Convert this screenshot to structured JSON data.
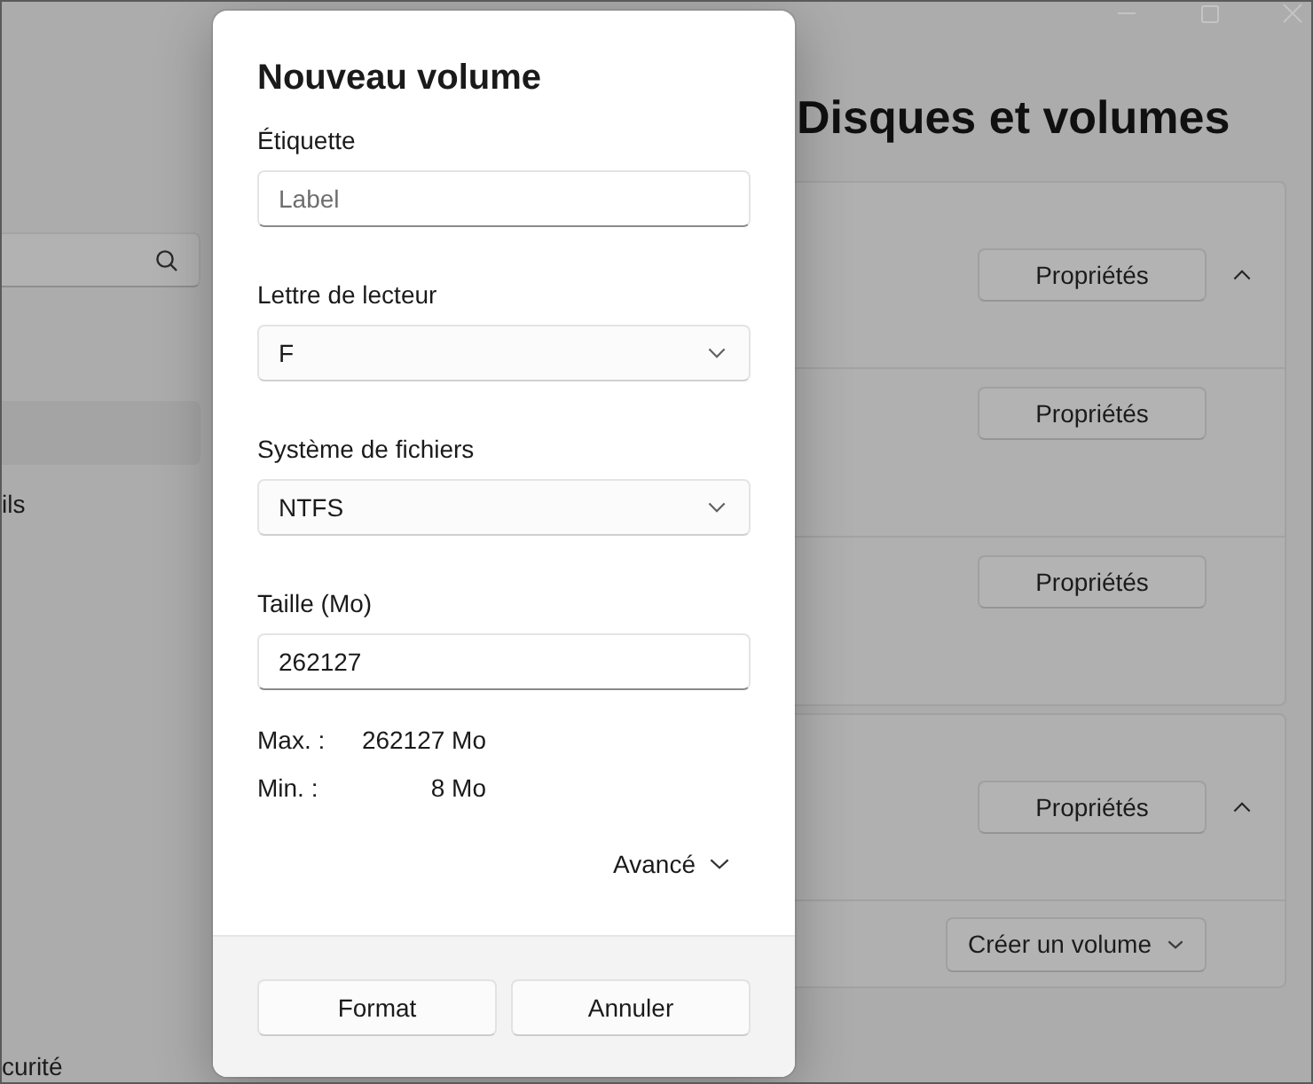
{
  "sidebar": {
    "items": [
      {
        "selected": true
      },
      {
        "label": "ils",
        "selected": false
      },
      {
        "label": "curité",
        "selected": false
      }
    ]
  },
  "page": {
    "title": "Disques et volumes",
    "cards": [
      {
        "rows": [
          {
            "kind": "disk",
            "button": "Propriétés",
            "expanded": true
          },
          {
            "kind": "volume",
            "button": "Propriétés"
          },
          {
            "kind": "volume",
            "button": "Propriétés"
          }
        ]
      },
      {
        "rows": [
          {
            "kind": "disk",
            "button": "Propriétés",
            "expanded": true
          },
          {
            "kind": "action",
            "button": "Créer un volume"
          }
        ]
      }
    ]
  },
  "dialog": {
    "title": "Nouveau volume",
    "fields": [
      {
        "kind": "text",
        "label": "Étiquette",
        "placeholder": "Label"
      },
      {
        "kind": "select",
        "label": "Lettre de lecteur",
        "value": "F"
      },
      {
        "kind": "select",
        "label": "Système de fichiers",
        "value": "NTFS"
      },
      {
        "kind": "text",
        "label": "Taille (Mo)",
        "value": "262127"
      }
    ],
    "limits": [
      {
        "label": "Max. :",
        "value": "262127 Mo"
      },
      {
        "label": "Min. :",
        "value": "8 Mo"
      }
    ],
    "advanced": {
      "label": "Avancé",
      "expanded": false
    },
    "buttons": [
      "Format",
      "Annuler"
    ]
  }
}
